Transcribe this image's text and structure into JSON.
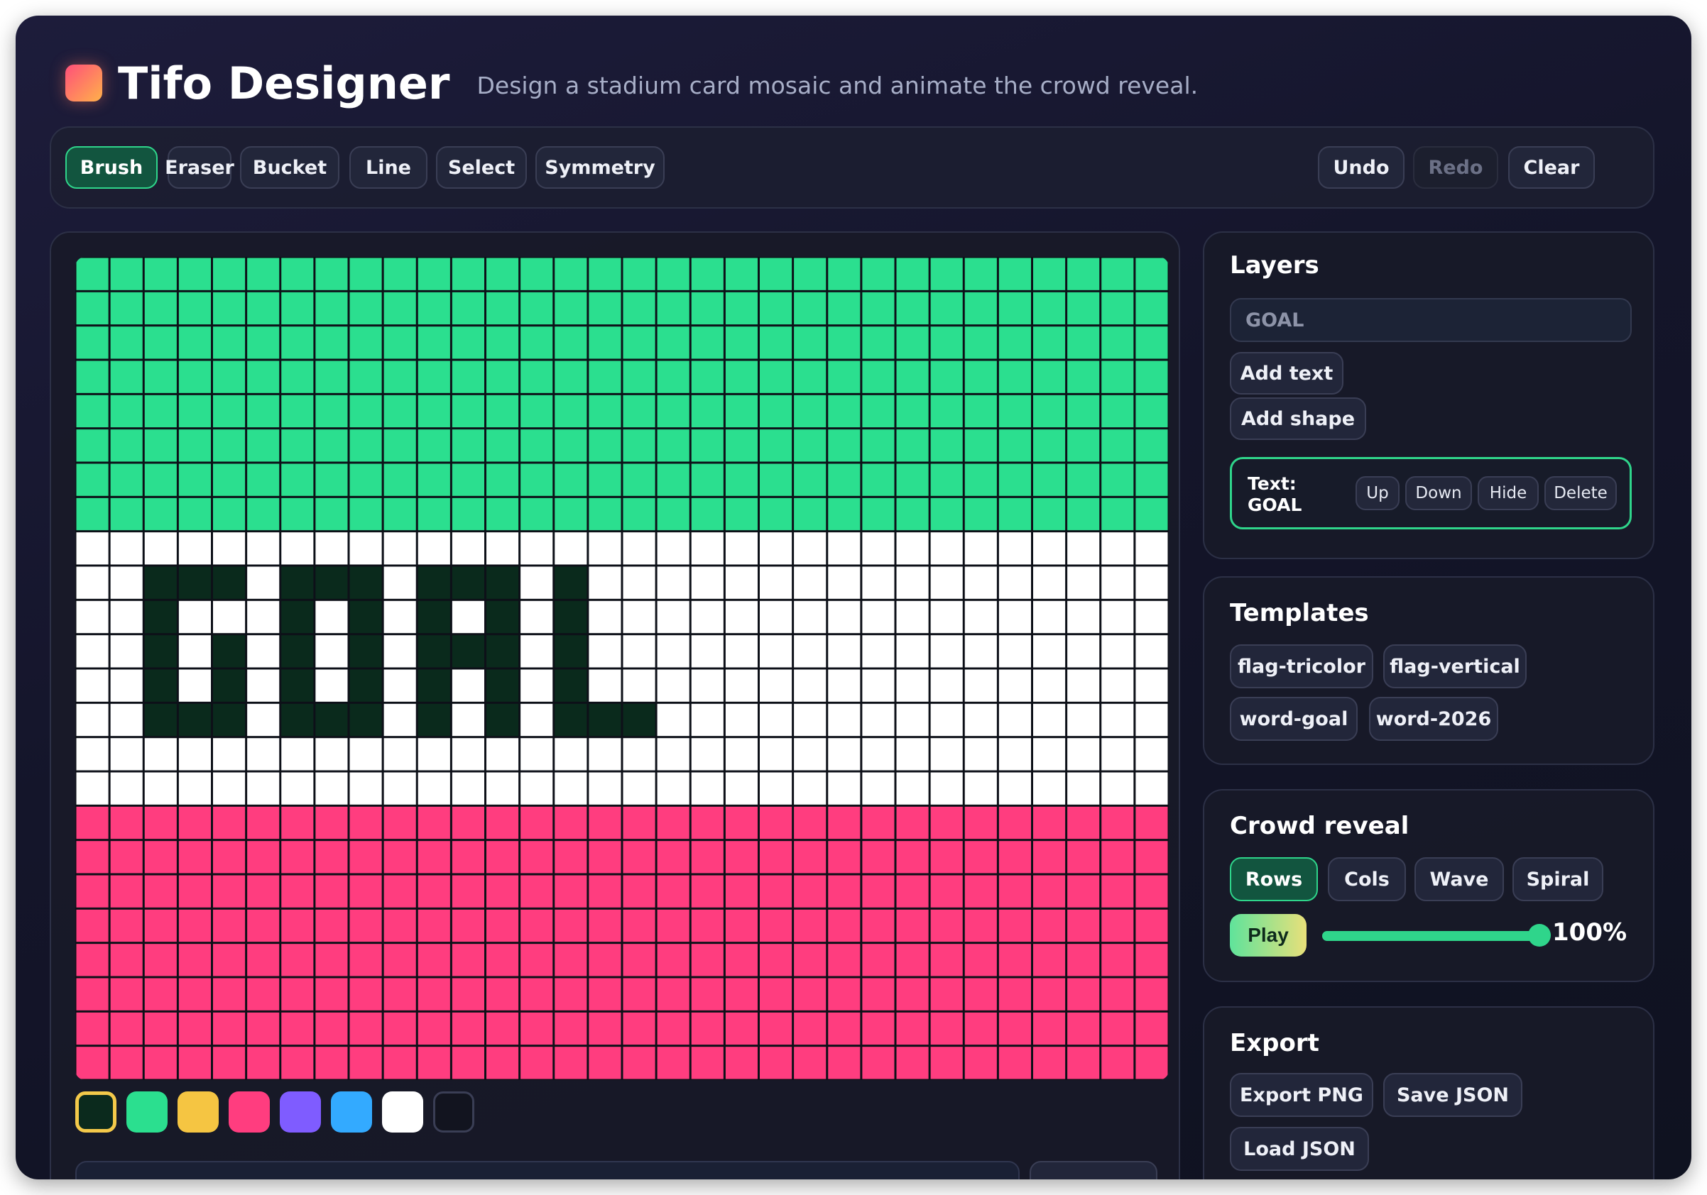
{
  "app": {
    "title": "Tifo Designer",
    "subtitle": "Design a stadium card mosaic and animate the crowd reveal."
  },
  "toolbar": {
    "tools": [
      "Brush",
      "Eraser",
      "Bucket",
      "Line",
      "Select",
      "Symmetry"
    ],
    "active_tool": "Brush",
    "undo": "Undo",
    "redo": "Redo",
    "redo_disabled": true,
    "clear": "Clear"
  },
  "mosaic": {
    "cols": 32,
    "rows": 24,
    "colors": {
      "green": "#2bdf8f",
      "white": "#ffffff",
      "pink": "#ff3d7f",
      "dark": "#0a2a1c"
    },
    "bands": [
      {
        "color": "green",
        "rows": 8
      },
      {
        "color": "white",
        "rows": 8
      },
      {
        "color": "pink",
        "rows": 8
      }
    ],
    "text": "GOAL"
  },
  "palette": {
    "colors": [
      "#0b2a1d",
      "#2bdf8f",
      "#f5c542",
      "#ff3d7f",
      "#7f5cff",
      "#33aaff",
      "#ffffff",
      "#12141f"
    ],
    "selected_index": 0
  },
  "layers": {
    "title": "Layers",
    "input_placeholder": "GOAL",
    "add_text": "Add text",
    "add_shape": "Add shape",
    "item": {
      "name": "Text: GOAL",
      "up": "Up",
      "down": "Down",
      "hide": "Hide",
      "delete": "Delete"
    }
  },
  "templates": {
    "title": "Templates",
    "items": [
      "flag-tricolor",
      "flag-vertical",
      "word-goal",
      "word-2026"
    ]
  },
  "reveal": {
    "title": "Crowd reveal",
    "modes": [
      "Rows",
      "Cols",
      "Wave",
      "Spiral"
    ],
    "active_mode": "Rows",
    "play": "Play",
    "progress": 1.0,
    "progress_label": "100%"
  },
  "export": {
    "title": "Export",
    "export_png": "Export PNG",
    "save_json": "Save JSON",
    "load_json": "Load JSON"
  },
  "accent": "#2fd58b"
}
